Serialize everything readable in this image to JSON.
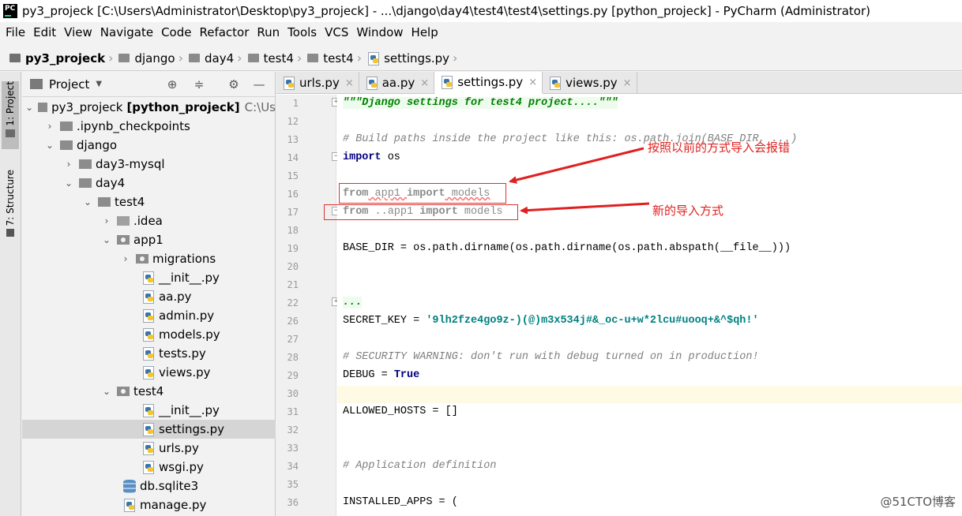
{
  "window": {
    "title": "py3_projeck [C:\\Users\\Administrator\\Desktop\\py3_projeck] - ...\\django\\day4\\test4\\test4\\settings.py [python_projeck] - PyCharm (Administrator)",
    "app_icon_text": "PC"
  },
  "menu": [
    "File",
    "Edit",
    "View",
    "Navigate",
    "Code",
    "Refactor",
    "Run",
    "Tools",
    "VCS",
    "Window",
    "Help"
  ],
  "breadcrumb": [
    "py3_projeck",
    "django",
    "day4",
    "test4",
    "test4",
    "settings.py"
  ],
  "sidebar_strip": {
    "project_tab": "1: Project",
    "structure_tab": "7: Structure"
  },
  "project_panel": {
    "title": "Project",
    "tree": [
      {
        "label": "py3_projeck",
        "suffix": "[python_projeck]",
        "muted": "C:\\Us"
      },
      {
        "label": ".ipynb_checkpoints"
      },
      {
        "label": "django"
      },
      {
        "label": "day3-mysql"
      },
      {
        "label": "day4"
      },
      {
        "label": "test4"
      },
      {
        "label": ".idea"
      },
      {
        "label": "app1"
      },
      {
        "label": "migrations"
      },
      {
        "label": "__init__.py"
      },
      {
        "label": "aa.py"
      },
      {
        "label": "admin.py"
      },
      {
        "label": "models.py"
      },
      {
        "label": "tests.py"
      },
      {
        "label": "views.py"
      },
      {
        "label": "test4"
      },
      {
        "label": "__init__.py"
      },
      {
        "label": "settings.py"
      },
      {
        "label": "urls.py"
      },
      {
        "label": "wsgi.py"
      },
      {
        "label": "db.sqlite3"
      },
      {
        "label": "manage.py"
      }
    ]
  },
  "tabs": [
    {
      "label": "urls.py",
      "close": "×"
    },
    {
      "label": "aa.py",
      "close": "×"
    },
    {
      "label": "settings.py",
      "close": "×"
    },
    {
      "label": "views.py",
      "close": "×"
    }
  ],
  "editor": {
    "line_numbers": [
      "1",
      "12",
      "13",
      "14",
      "15",
      "16",
      "17",
      "18",
      "19",
      "20",
      "21",
      "22",
      "26",
      "27",
      "28",
      "29",
      "30",
      "31",
      "32",
      "33",
      "34",
      "35",
      "36"
    ],
    "lines": {
      "l1": "\"\"\"Django settings for test4 project....\"\"\"",
      "l13": "# Build paths inside the project like this: os.path.join(BASE_DIR, ...)",
      "l14_kw": "import",
      "l14_rest": " os",
      "l16_kw1": "from",
      "l16_mod": " app1 ",
      "l16_kw2": "import",
      "l16_rest": " models",
      "l17_kw1": "from",
      "l17_mod": " ..app1 ",
      "l17_kw2": "import",
      "l17_rest": " models",
      "l19": "BASE_DIR = os.path.dirname(os.path.dirname(os.path.abspath(__file__)))",
      "l22": "...",
      "l26_a": "SECRET_KEY = ",
      "l26_str": "'9lh2fze4go9z-)(@)m3x534j#&_oc-u+w*2lcu#uooq+&^$qh!'",
      "l28": "# SECURITY WARNING: don't run with debug turned on in production!",
      "l29_a": "DEBUG = ",
      "l29_kw": "True",
      "l31": "ALLOWED_HOSTS = []",
      "l34": "# Application definition",
      "l36": "INSTALLED_APPS = ("
    }
  },
  "annotations": {
    "old_import": "按照以前的方式导入会报错",
    "new_import": "新的导入方式"
  },
  "watermark": "@51CTO博客"
}
